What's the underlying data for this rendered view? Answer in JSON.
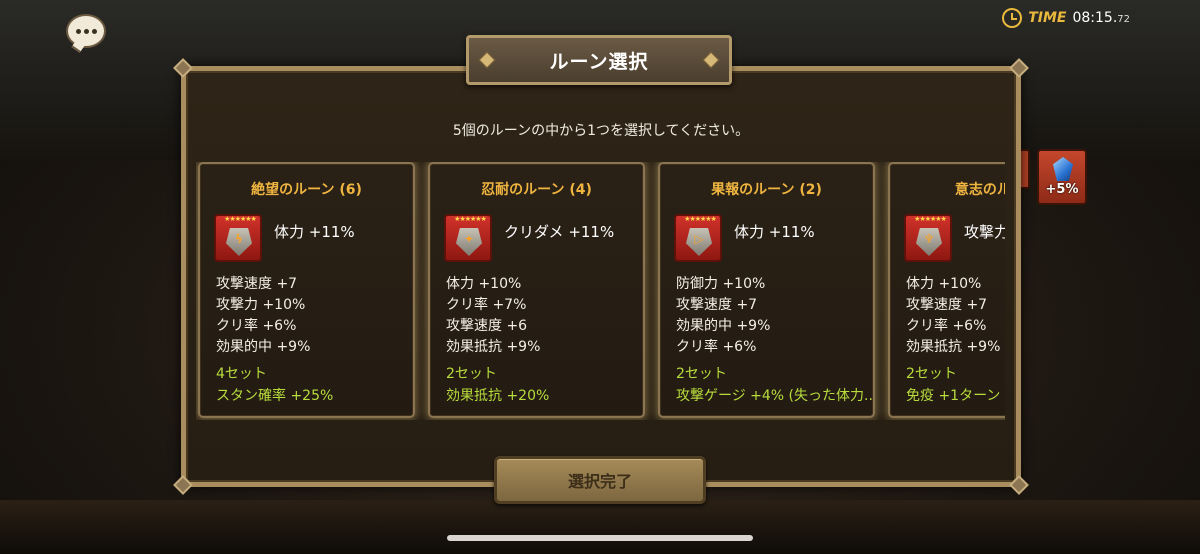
{
  "header": {
    "time_label": "TIME",
    "time_value": "08:15.",
    "time_fraction": "72"
  },
  "dialog": {
    "title": "ルーン選択",
    "instruction": "5個のルーンの中から1つを選択してください。",
    "confirm_label": "選択完了"
  },
  "bonus": {
    "label": "+5%",
    "icon": "blue-gem-icon"
  },
  "runes": [
    {
      "name": "絶望のルーン (6)",
      "stars": "★★★★★★",
      "main_stat": "体力 +11%",
      "substats": [
        "攻撃速度 +7",
        "攻撃力 +10%",
        "クリ率 +6%",
        "効果的中 +9%"
      ],
      "set_name": "4セット",
      "set_effect": "スタン確率 +25%"
    },
    {
      "name": "忍耐のルーン (4)",
      "stars": "★★★★★★",
      "main_stat": "クリダメ +11%",
      "substats": [
        "体力 +10%",
        "クリ率 +7%",
        "攻撃速度 +6",
        "効果抵抗 +9%"
      ],
      "set_name": "2セット",
      "set_effect": "効果抵抗 +20%"
    },
    {
      "name": "果報のルーン (2)",
      "stars": "★★★★★★",
      "main_stat": "体力 +11%",
      "substats": [
        "防御力 +10%",
        "攻撃速度 +7",
        "効果的中 +9%",
        "クリ率 +6%"
      ],
      "set_name": "2セット",
      "set_effect": "攻撃ゲージ +4% (失った体力.."
    },
    {
      "name": "意志のルーン",
      "stars": "★★★★★★",
      "main_stat": "攻撃力",
      "substats": [
        "体力 +10%",
        "攻撃速度 +7",
        "クリ率 +6%",
        "効果抵抗 +9%"
      ],
      "set_name": "2セット",
      "set_effect": "免疫 +1ターン"
    }
  ],
  "colors": {
    "title_gold": "#f0b540",
    "set_green": "#b8dc3c",
    "frame": "#a98d5e"
  }
}
